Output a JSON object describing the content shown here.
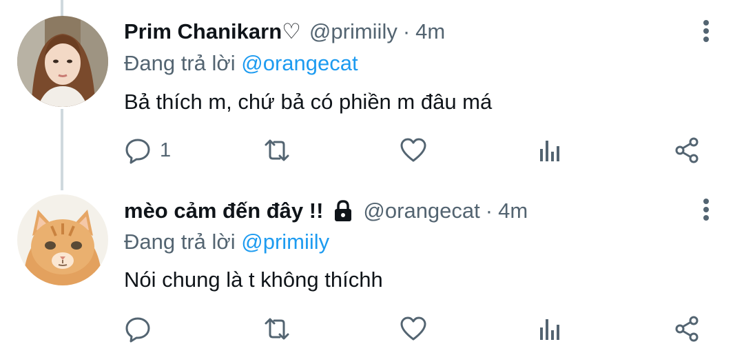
{
  "tweets": [
    {
      "display_name": "Prim Chanikarn♡",
      "handle": "@primiily",
      "separator": "·",
      "time": "4m",
      "reply_prefix": "Đang trả lời",
      "reply_to": "@orangecat",
      "text": "Bả thích m, chứ bả có phiền m đâu má",
      "reply_count": "1",
      "avatar": "girl-portrait"
    },
    {
      "display_name": "mèo cảm đến đây !!",
      "handle": "@orangecat",
      "separator": "·",
      "time": "4m",
      "reply_prefix": "Đang trả lời",
      "reply_to": "@primiily",
      "text": "Nói chung là t không thíchh",
      "reply_count": "",
      "avatar": "orange-cat",
      "protected": true
    }
  ],
  "icons": [
    "reply-icon",
    "retweet-icon",
    "like-icon",
    "analytics-icon",
    "share-icon",
    "more-icon",
    "lock-icon"
  ],
  "colors": {
    "text": "#0f1419",
    "secondary": "#536471",
    "link": "#1d9bf0",
    "thread_line": "#cfd9de"
  }
}
